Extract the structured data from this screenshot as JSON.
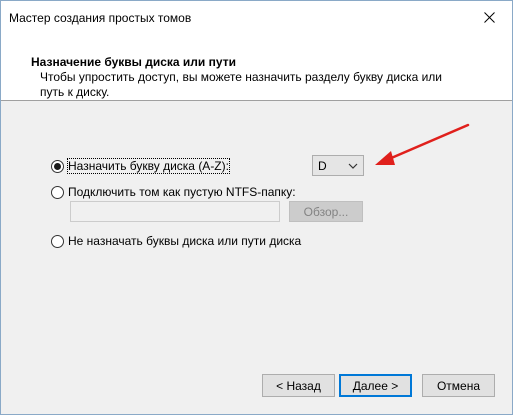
{
  "window": {
    "title": "Мастер создания простых томов"
  },
  "header": {
    "title": "Назначение буквы диска или пути",
    "description": "Чтобы упростить доступ, вы можете назначить разделу букву диска или путь к диску."
  },
  "options": {
    "assign_letter": {
      "label": "Назначить букву диска (A-Z):",
      "selected": true
    },
    "mount_folder": {
      "label": "Подключить том как пустую NTFS-папку:",
      "selected": false
    },
    "no_assign": {
      "label": "Не назначать буквы диска или пути диска",
      "selected": false
    }
  },
  "drive_letter": {
    "value": "D"
  },
  "folder_path": {
    "value": "",
    "browse_label": "Обзор..."
  },
  "buttons": {
    "back": "< Назад",
    "next": "Далее >",
    "cancel": "Отмена"
  },
  "colors": {
    "arrow": "#e0201c",
    "focus_border": "#0078d7"
  },
  "icons": {
    "close": "close-icon",
    "dropdown": "chevron-down-icon"
  }
}
